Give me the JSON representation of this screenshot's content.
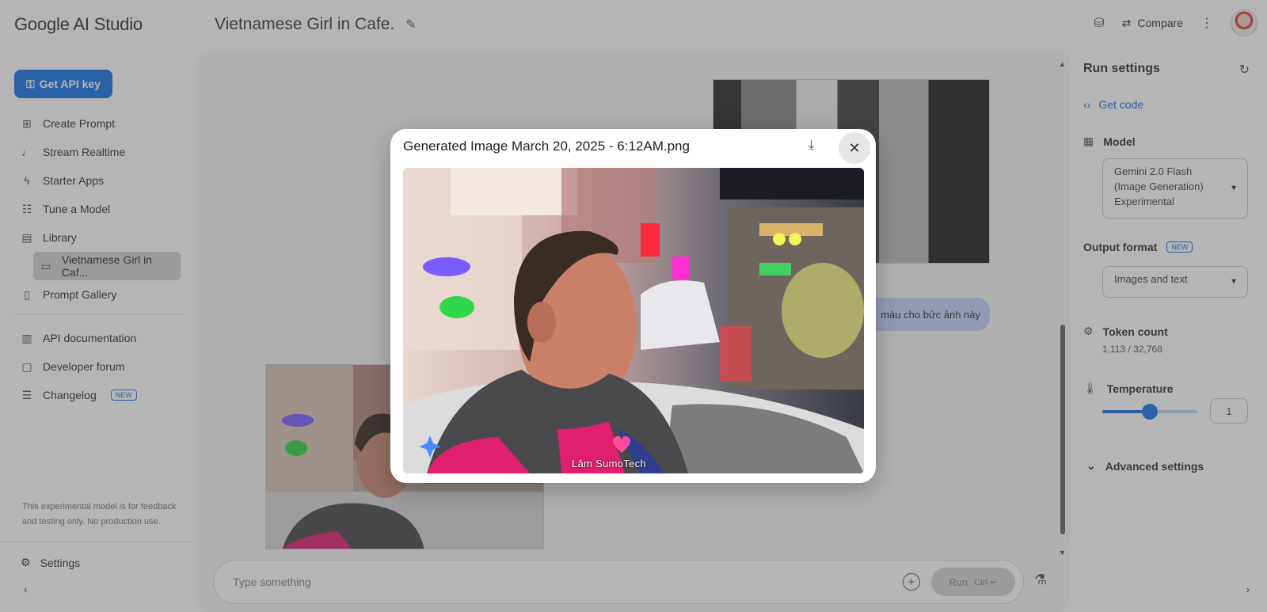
{
  "app": {
    "brand": "Google AI Studio"
  },
  "header": {
    "doc_title": "Vietnamese Girl in Cafe.",
    "compare_label": "Compare"
  },
  "sidebar": {
    "api_key_label": "Get API key",
    "items": [
      {
        "label": "Create Prompt",
        "icon": "create-prompt-icon"
      },
      {
        "label": "Stream Realtime",
        "icon": "mic-icon"
      },
      {
        "label": "Starter Apps",
        "icon": "bolt-icon"
      },
      {
        "label": "Tune a Model",
        "icon": "tune-icon"
      },
      {
        "label": "Library",
        "icon": "library-icon"
      },
      {
        "label": "Vietnamese Girl in Caf...",
        "icon": "chat-icon"
      },
      {
        "label": "Prompt Gallery",
        "icon": "gallery-icon"
      }
    ],
    "resources": [
      {
        "label": "API documentation",
        "icon": "doc-icon"
      },
      {
        "label": "Developer forum",
        "icon": "forum-icon"
      },
      {
        "label": "Changelog",
        "icon": "changelog-icon",
        "badge": "NEW"
      }
    ],
    "disclaimer": "This experimental model is for feedback and testing only. No production use.",
    "settings_label": "Settings"
  },
  "chat": {
    "user_message_fragment": "màu cho bức ảnh này",
    "composer_placeholder": "Type something",
    "run_label": "Run",
    "run_shortcut": "Ctrl ↵"
  },
  "run_settings": {
    "title": "Run settings",
    "get_code_label": "Get code",
    "model_label": "Model",
    "model_value": "Gemini 2.0 Flash (Image Generation) Experimental",
    "output_format_label": "Output format",
    "output_format_badge": "NEW",
    "output_format_value": "Images and text",
    "token_count_label": "Token count",
    "token_count_value": "1,113 / 32,768",
    "temperature_label": "Temperature",
    "temperature_value": "1",
    "advanced_label": "Advanced settings"
  },
  "modal": {
    "title": "Generated Image March 20, 2025 - 6:12AM.png",
    "watermark": "Lâm SumoTech"
  },
  "colors": {
    "accent": "#1a73e8",
    "user_bubble": "#c7d2fe",
    "hoodie": "#e0206e"
  }
}
